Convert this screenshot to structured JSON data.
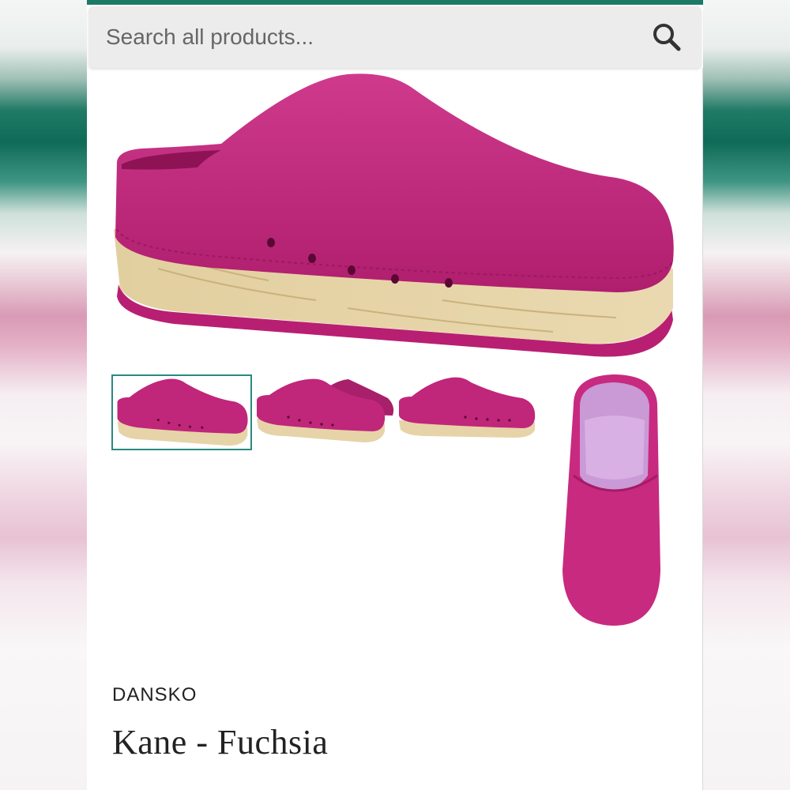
{
  "search": {
    "placeholder": "Search all products...",
    "icon": "search-icon"
  },
  "colors": {
    "accent": "#1b7a66",
    "product": "#c0267a",
    "sole": "#e6d3a8"
  },
  "gallery": {
    "main_image": "fuchsia clog side view",
    "thumbnails": [
      {
        "label": "side view",
        "active": true
      },
      {
        "label": "pair view",
        "active": false
      },
      {
        "label": "side view alt",
        "active": false
      },
      {
        "label": "top view",
        "active": false
      }
    ]
  },
  "product": {
    "brand": "DANSKO",
    "title": "Kane - Fuchsia"
  }
}
